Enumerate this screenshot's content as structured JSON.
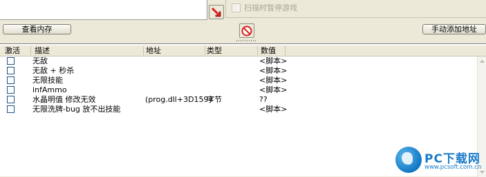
{
  "top": {
    "pause_game_label": "扫描时暂停游戏",
    "view_memory_label": "查看内存",
    "add_address_label": "手动添加地址"
  },
  "table": {
    "columns": {
      "active": "激活",
      "description": "描述",
      "address": "地址",
      "type": "类型",
      "value": "数值"
    },
    "rows": [
      {
        "description": "无敌",
        "address": "",
        "type": "",
        "value": "<脚本>"
      },
      {
        "description": "无敌 + 秒杀",
        "address": "",
        "type": "",
        "value": "<脚本>"
      },
      {
        "description": "无限技能",
        "address": "",
        "type": "",
        "value": "<脚本>"
      },
      {
        "description": "infAmmo",
        "address": "",
        "type": "",
        "value": "<脚本>"
      },
      {
        "description": "水晶明值 修改无效",
        "address": "(prog.dll+3D1594",
        "type": "字节",
        "value": "??"
      },
      {
        "description": "无限洗牌-bug 放不出技能",
        "address": "",
        "type": "",
        "value": "<脚本>"
      }
    ]
  },
  "watermark": {
    "brand": "PC下载网",
    "url": "www.pcsoft.com.cn"
  },
  "colors": {
    "window_bg": "#ece9d8",
    "checkbox_border": "#1c5180",
    "accent_red": "#d81e1e",
    "watermark_blue": "#1a7bc9"
  }
}
